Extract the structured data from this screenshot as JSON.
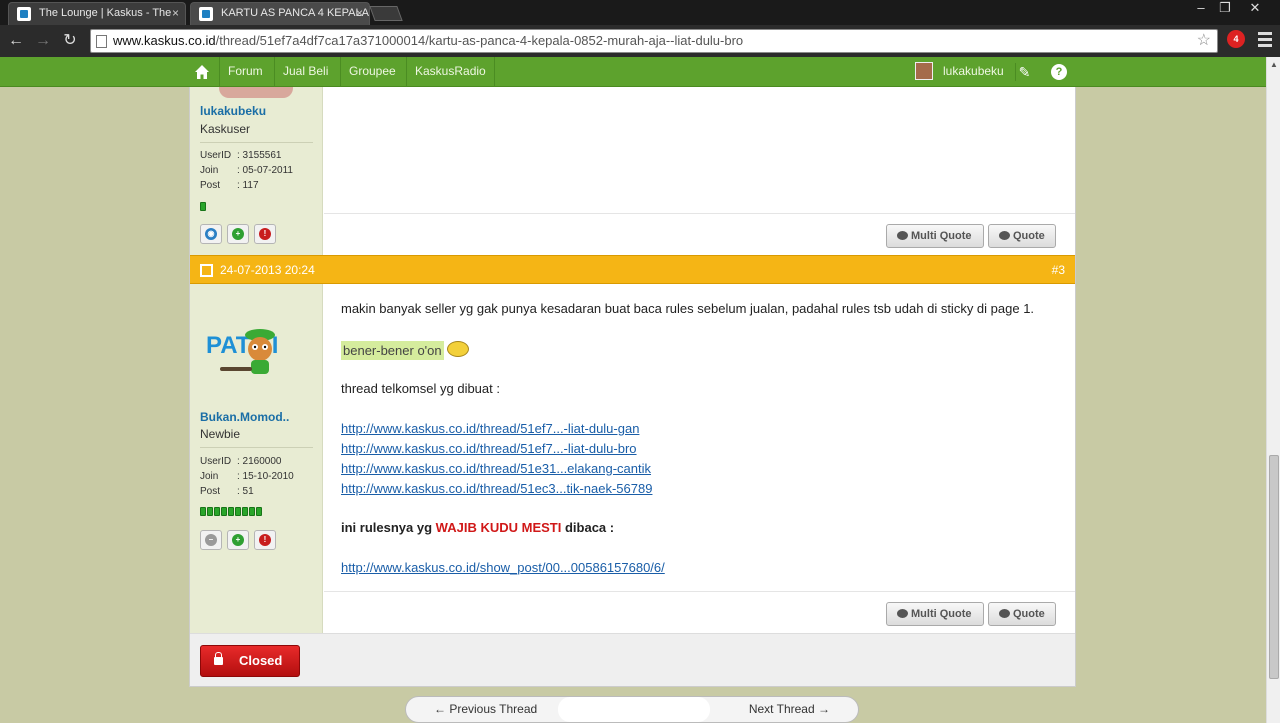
{
  "browser": {
    "tabs": [
      {
        "title": "The Lounge | Kaskus - The"
      },
      {
        "title": "KARTU AS PANCA 4 KEPALA"
      }
    ],
    "url_host": "www.kaskus.co.id",
    "url_path": "/thread/51ef7a4df7ca17a371000014/kartu-as-panca-4-kepala-0852-murah-aja--liat-dulu-bro",
    "extension_badge": "4"
  },
  "nav": {
    "items": [
      "Forum",
      "Jual Beli",
      "Groupee",
      "KaskusRadio"
    ],
    "user": "lukakubeku"
  },
  "post1": {
    "username": "lukakubeku",
    "rank": "Kaskuser",
    "userid_label": "UserID",
    "userid": ": 3155561",
    "join_label": "Join",
    "join": ": 05-07-2011",
    "post_label": "Post",
    "post": ": 117",
    "multiquote": "Multi Quote",
    "quote": "Quote"
  },
  "post2": {
    "date": "24-07-2013 20:24",
    "number": "#3",
    "username": "Bukan.Momod..",
    "rank": "Newbie",
    "userid_label": "UserID",
    "userid": ": 2160000",
    "join_label": "Join",
    "join": ": 15-10-2010",
    "post_label": "Post",
    "post": ": 51",
    "avatar_text": "PAT LI",
    "line1": "makin banyak seller yg gak punya kesadaran buat baca rules sebelum jualan, padahal rules tsb udah di sticky di page 1.",
    "line2": "bener-bener o'on",
    "line3": "thread telkomsel yg dibuat :",
    "links": [
      "http://www.kaskus.co.id/thread/51ef7...-liat-dulu-gan",
      "http://www.kaskus.co.id/thread/51ef7...-liat-dulu-bro",
      "http://www.kaskus.co.id/thread/51e31...elakang-cantik",
      "http://www.kaskus.co.id/thread/51ec3...tik-naek-56789"
    ],
    "rules_a": "ini rulesnya yg",
    "rules_red": "WAJIB KUDU MESTI",
    "rules_b": "dibaca :",
    "rules_link": "http://www.kaskus.co.id/show_post/00...00586157680/6/",
    "multiquote": "Multi Quote",
    "quote": "Quote"
  },
  "closed_label": "Closed",
  "pager": {
    "prev": "Previous Thread",
    "next": "Next Thread"
  }
}
